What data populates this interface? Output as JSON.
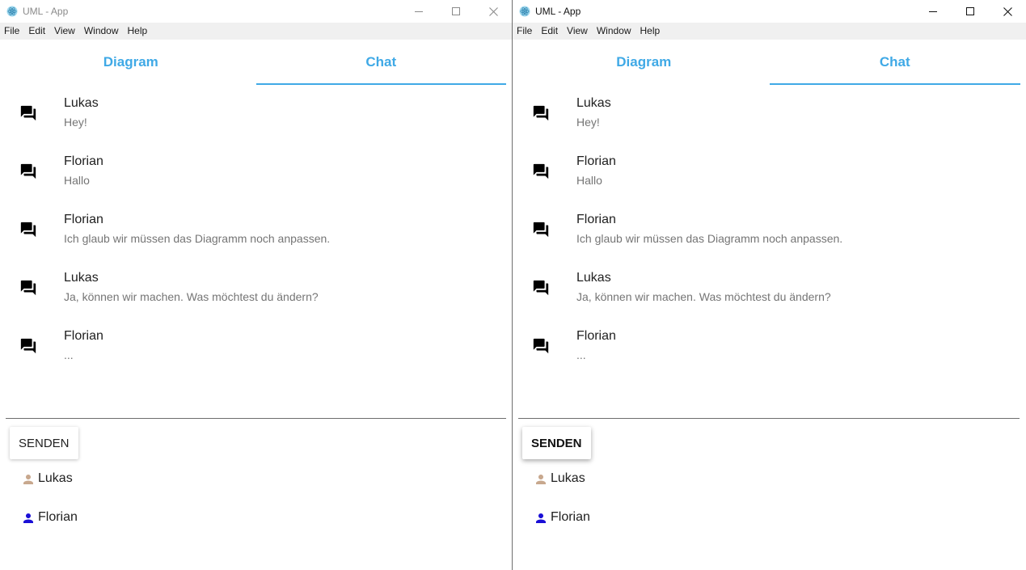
{
  "windows": [
    {
      "title": "UML - App",
      "menu": [
        "File",
        "Edit",
        "View",
        "Window",
        "Help"
      ],
      "tabs": [
        {
          "label": "Diagram",
          "active": false
        },
        {
          "label": "Chat",
          "active": true
        }
      ],
      "messages": [
        {
          "author": "Lukas",
          "text": "Hey!"
        },
        {
          "author": "Florian",
          "text": "Hallo"
        },
        {
          "author": "Florian",
          "text": "Ich glaub wir müssen das Diagramm noch anpassen."
        },
        {
          "author": "Lukas",
          "text": "Ja, können wir machen. Was möchtest du ändern?"
        },
        {
          "author": "Florian",
          "text": "..."
        }
      ],
      "send_label": "SENDEN",
      "users": [
        {
          "name": "Lukas",
          "color": "#c8a88e"
        },
        {
          "name": "Florian",
          "color": "#1a0fd6"
        }
      ]
    },
    {
      "title": "UML - App",
      "menu": [
        "File",
        "Edit",
        "View",
        "Window",
        "Help"
      ],
      "tabs": [
        {
          "label": "Diagram",
          "active": false
        },
        {
          "label": "Chat",
          "active": true
        }
      ],
      "messages": [
        {
          "author": "Lukas",
          "text": "Hey!"
        },
        {
          "author": "Florian",
          "text": "Hallo"
        },
        {
          "author": "Florian",
          "text": "Ich glaub wir müssen das Diagramm noch anpassen."
        },
        {
          "author": "Lukas",
          "text": "Ja, können wir machen. Was möchtest du ändern?"
        },
        {
          "author": "Florian",
          "text": "..."
        }
      ],
      "send_label": "SENDEN",
      "users": [
        {
          "name": "Lukas",
          "color": "#c8a88e"
        },
        {
          "name": "Florian",
          "color": "#1a0fd6"
        }
      ]
    }
  ],
  "icons": {
    "app": "electron-atom-icon",
    "message": "forum-chat-icon",
    "user": "person-icon",
    "minimize": "minimize-icon",
    "maximize": "maximize-icon",
    "close": "close-icon"
  },
  "colors": {
    "accent": "#3fa9e6",
    "menubar_bg": "#f0f0f0",
    "secondary_text": "#757575"
  }
}
